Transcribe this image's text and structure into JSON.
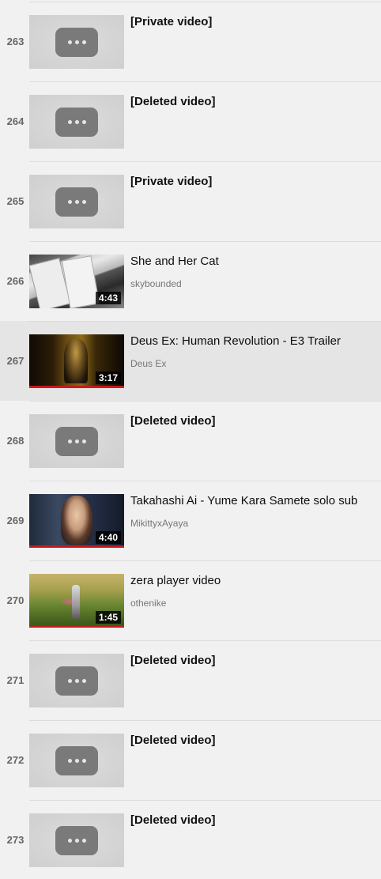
{
  "playlist": {
    "items": [
      {
        "index": "263",
        "title": "[Private video]",
        "channel": "",
        "duration": "",
        "thumb": "placeholder"
      },
      {
        "index": "264",
        "title": "[Deleted video]",
        "channel": "",
        "duration": "",
        "thumb": "placeholder"
      },
      {
        "index": "265",
        "title": "[Private video]",
        "channel": "",
        "duration": "",
        "thumb": "placeholder"
      },
      {
        "index": "266",
        "title": "She and Her Cat",
        "channel": "skybounded",
        "duration": "4:43",
        "thumb": "cat"
      },
      {
        "index": "267",
        "title": "Deus Ex: Human Revolution - E3 Trailer",
        "channel": "Deus Ex",
        "duration": "3:17",
        "thumb": "deus",
        "watched_fraction": 1.0,
        "active": true
      },
      {
        "index": "268",
        "title": "[Deleted video]",
        "channel": "",
        "duration": "",
        "thumb": "placeholder"
      },
      {
        "index": "269",
        "title": "Takahashi Ai - Yume Kara Samete solo sub",
        "channel": "MikittyxAyaya",
        "duration": "4:40",
        "thumb": "takahashi",
        "watched_fraction": 1.0
      },
      {
        "index": "270",
        "title": "zera player video",
        "channel": "othenike",
        "duration": "1:45",
        "thumb": "zera",
        "watched_fraction": 1.0
      },
      {
        "index": "271",
        "title": "[Deleted video]",
        "channel": "",
        "duration": "",
        "thumb": "placeholder"
      },
      {
        "index": "272",
        "title": "[Deleted video]",
        "channel": "",
        "duration": "",
        "thumb": "placeholder"
      },
      {
        "index": "273",
        "title": "[Deleted video]",
        "channel": "",
        "duration": "",
        "thumb": "placeholder"
      }
    ],
    "colors": {
      "progress": "#cc181e",
      "active_row_bg": "#e5e5e5",
      "page_bg": "#f1f1f1"
    },
    "icons": {
      "placeholder": "more-dots-icon"
    }
  }
}
